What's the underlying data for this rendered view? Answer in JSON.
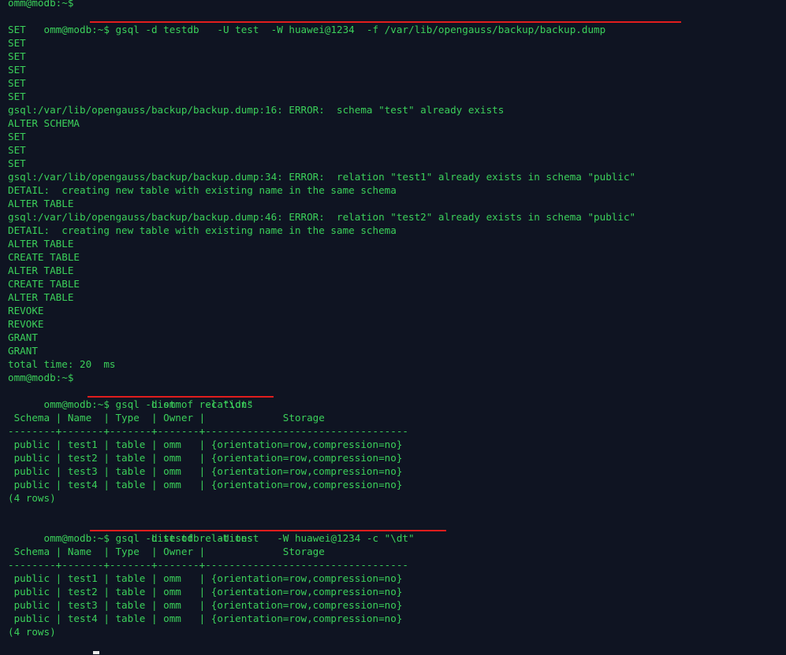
{
  "lines": [
    "omm@modb:~$",
    "omm@modb:~$ gsql -d testdb   -U test  -W huawei@1234  -f /var/lib/opengauss/backup/backup.dump",
    "SET",
    "SET",
    "SET",
    "SET",
    "SET",
    "SET",
    "gsql:/var/lib/opengauss/backup/backup.dump:16: ERROR:  schema \"test\" already exists",
    "ALTER SCHEMA",
    "SET",
    "SET",
    "SET",
    "gsql:/var/lib/opengauss/backup/backup.dump:34: ERROR:  relation \"test1\" already exists in schema \"public\"",
    "DETAIL:  creating new table with existing name in the same schema",
    "ALTER TABLE",
    "gsql:/var/lib/opengauss/backup/backup.dump:46: ERROR:  relation \"test2\" already exists in schema \"public\"",
    "DETAIL:  creating new table with existing name in the same schema",
    "ALTER TABLE",
    "CREATE TABLE",
    "ALTER TABLE",
    "CREATE TABLE",
    "ALTER TABLE",
    "REVOKE",
    "REVOKE",
    "GRANT",
    "GRANT",
    "total time: 20  ms",
    "omm@modb:~$",
    "omm@modb:~$ gsql -d omm    -c \"\\dt\"",
    "                        List of relations",
    " Schema | Name  | Type  | Owner |             Storage",
    "--------+-------+-------+-------+----------------------------------",
    " public | test1 | table | omm   | {orientation=row,compression=no}",
    " public | test2 | table | omm   | {orientation=row,compression=no}",
    " public | test3 | table | omm   | {orientation=row,compression=no}",
    " public | test4 | table | omm   | {orientation=row,compression=no}",
    "(4 rows)",
    "",
    "omm@modb:~$ gsql -d testdb   -U test   -W huawei@1234 -c \"\\dt\"",
    "                        List of relations",
    " Schema | Name  | Type  | Owner |             Storage",
    "--------+-------+-------+-------+----------------------------------",
    " public | test1 | table | omm   | {orientation=row,compression=no}",
    " public | test2 | table | omm   | {orientation=row,compression=no}",
    " public | test3 | table | omm   | {orientation=row,compression=no}",
    " public | test4 | table | omm   | {orientation=row,compression=no}",
    "(4 rows)"
  ],
  "colors": {
    "background": "#0f1422",
    "text": "#3bd05a",
    "annotation": "#e21d1d"
  }
}
